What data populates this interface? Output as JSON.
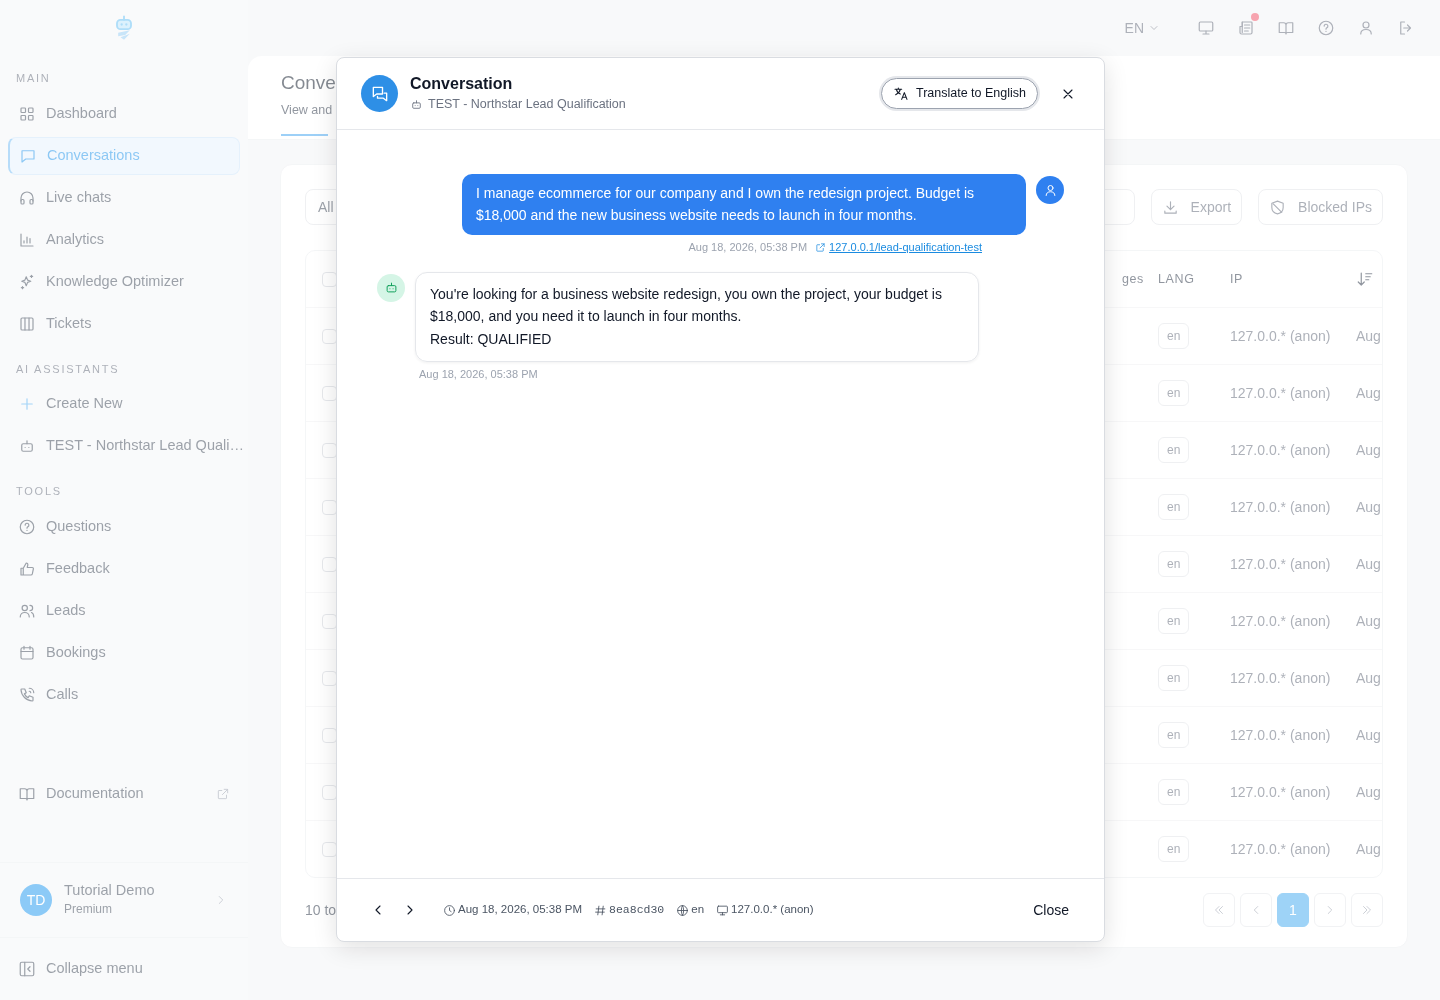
{
  "topbar": {
    "language": "EN",
    "unread": true
  },
  "sidebar": {
    "sections": [
      {
        "title": "MAIN",
        "items": [
          {
            "label": "Dashboard",
            "selected": false
          },
          {
            "label": "Conversations",
            "selected": true
          },
          {
            "label": "Live chats",
            "selected": false
          },
          {
            "label": "Analytics",
            "selected": false
          },
          {
            "label": "Knowledge Optimizer",
            "selected": false
          },
          {
            "label": "Tickets",
            "selected": false
          }
        ]
      },
      {
        "title": "AI ASSISTANTS",
        "items": [
          {
            "label": "Create New",
            "selected": false,
            "kind": "action"
          },
          {
            "label": "TEST - Northstar Lead Quali…",
            "selected": false
          }
        ]
      },
      {
        "title": "TOOLS",
        "items": [
          {
            "label": "Questions",
            "selected": false
          },
          {
            "label": "Feedback",
            "selected": false
          },
          {
            "label": "Leads",
            "selected": false
          },
          {
            "label": "Bookings",
            "selected": false
          },
          {
            "label": "Calls",
            "selected": false
          }
        ]
      }
    ],
    "documentation": "Documentation",
    "user": {
      "initials": "TD",
      "name": "Tutorial Demo",
      "plan": "Premium"
    },
    "collapse": "Collapse menu"
  },
  "page": {
    "title": "Conve",
    "subtitle": "View and",
    "filter": "All",
    "buttons": [
      "Export",
      "Blocked IPs"
    ],
    "table": {
      "all_checked": false,
      "columns": [
        "ges",
        "LANG",
        "IP"
      ],
      "rows": [
        {
          "checked": false,
          "lang": "en",
          "ip": "127.0.0.* (anon)",
          "date": "Aug"
        },
        {
          "checked": false,
          "lang": "en",
          "ip": "127.0.0.* (anon)",
          "date": "Aug"
        },
        {
          "checked": false,
          "lang": "en",
          "ip": "127.0.0.* (anon)",
          "date": "Aug"
        },
        {
          "checked": false,
          "lang": "en",
          "ip": "127.0.0.* (anon)",
          "date": "Aug"
        },
        {
          "checked": false,
          "lang": "en",
          "ip": "127.0.0.* (anon)",
          "date": "Aug"
        },
        {
          "checked": false,
          "lang": "en",
          "ip": "127.0.0.* (anon)",
          "date": "Aug"
        },
        {
          "checked": false,
          "lang": "en",
          "ip": "127.0.0.* (anon)",
          "date": "Aug"
        },
        {
          "checked": false,
          "lang": "en",
          "ip": "127.0.0.* (anon)",
          "date": "Aug"
        },
        {
          "checked": false,
          "lang": "en",
          "ip": "127.0.0.* (anon)",
          "date": "Aug"
        },
        {
          "checked": false,
          "lang": "en",
          "ip": "127.0.0.* (anon)",
          "date": "Aug"
        }
      ]
    },
    "pagination": {
      "summary": "10 to",
      "pages": [
        {
          "label": "1",
          "selected": true
        }
      ]
    }
  },
  "modal": {
    "title": "Conversation",
    "assistant": "TEST - Northstar Lead Qualification",
    "translate_button": "Translate to English",
    "messages": [
      {
        "kind": "user",
        "text": "I manage ecommerce for our company and I own the redesign project. Budget is $18,000 and the new business website needs to launch in four months.",
        "time": "Aug 18, 2026, 05:38 PM",
        "link": "127.0.0.1/lead-qualification-test"
      },
      {
        "kind": "bot",
        "text": "You're looking for a business website redesign, you own the project, your budget is $18,000, and you need it to launch in four months.\nResult: QUALIFIED",
        "time": "Aug 18, 2026, 05:38 PM"
      }
    ],
    "footer": {
      "time": "Aug 18, 2026, 05:38 PM",
      "id": "8ea8cd30",
      "lang": "en",
      "ip": "127.0.0.* (anon)",
      "close": "Close"
    }
  }
}
